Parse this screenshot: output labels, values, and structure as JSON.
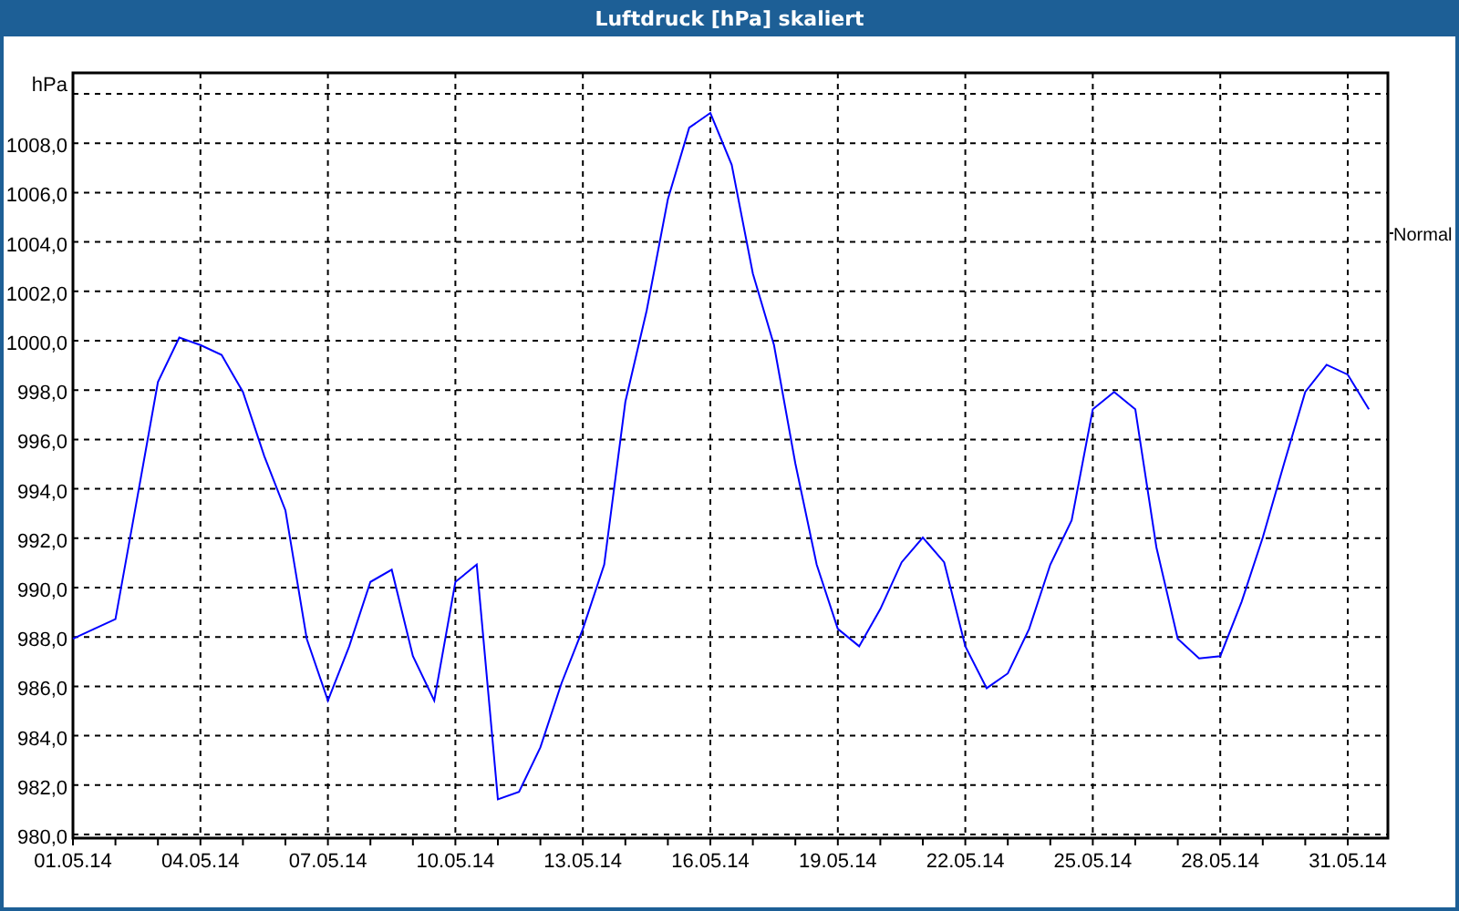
{
  "window": {
    "title": "Luftdruck [hPa] skaliert"
  },
  "chart_data": {
    "type": "line",
    "ylabel": "hPa",
    "categories": [
      "01.05.14",
      null,
      null,
      null,
      null,
      null,
      "04.05.14",
      null,
      null,
      null,
      null,
      null,
      "07.05.14",
      null,
      null,
      null,
      null,
      null,
      "10.05.14",
      null,
      null,
      null,
      null,
      null,
      "13.05.14",
      null,
      null,
      null,
      null,
      null,
      "16.05.14",
      null,
      null,
      null,
      null,
      null,
      "19.05.14",
      null,
      null,
      null,
      null,
      null,
      "22.05.14",
      null,
      null,
      null,
      null,
      null,
      "25.05.14",
      null,
      null,
      null,
      null,
      null,
      "28.05.14",
      null,
      null,
      null,
      null,
      null,
      "31.05.14",
      null
    ],
    "series": [
      {
        "color": "#0000ff",
        "values": [
          988.0,
          988.4,
          988.8,
          993.6,
          998.4,
          1000.2,
          999.9,
          999.5,
          998.0,
          995.4,
          993.2,
          988.0,
          985.5,
          987.7,
          990.3,
          990.8,
          987.3,
          985.5,
          990.3,
          991.0,
          981.5,
          981.8,
          983.6,
          986.2,
          988.4,
          991.0,
          997.6,
          1001.3,
          1005.8,
          1008.7,
          1009.3,
          1007.2,
          1002.8,
          999.9,
          995.1,
          991.0,
          988.4,
          987.7,
          989.2,
          991.1,
          992.1,
          991.1,
          987.7,
          986.0,
          986.6,
          988.4,
          991.0,
          992.8,
          997.3,
          998.0,
          997.3,
          991.7,
          988.0,
          987.2,
          987.3,
          989.5,
          992.1,
          995.1,
          998.0,
          999.1,
          998.7,
          997.3
        ]
      }
    ],
    "ylim": [
      980,
      1011
    ],
    "grid": true,
    "yticks": [
      {
        "value": 980,
        "label": "980,0"
      },
      {
        "value": 982,
        "label": "982,0"
      },
      {
        "value": 984,
        "label": "984,0"
      },
      {
        "value": 986,
        "label": "986,0"
      },
      {
        "value": 988,
        "label": "988,0"
      },
      {
        "value": 990,
        "label": "990,0"
      },
      {
        "value": 992,
        "label": "992,0"
      },
      {
        "value": 994,
        "label": "994,0"
      },
      {
        "value": 996,
        "label": "996,0"
      },
      {
        "value": 998,
        "label": "998,0"
      },
      {
        "value": 1000,
        "label": "1000,0"
      },
      {
        "value": 1002,
        "label": "1002,0"
      },
      {
        "value": 1004,
        "label": "1004,0"
      },
      {
        "value": 1006,
        "label": "1006,0"
      },
      {
        "value": 1008,
        "label": "1008,0"
      }
    ],
    "annotations": [
      "Normal"
    ]
  }
}
